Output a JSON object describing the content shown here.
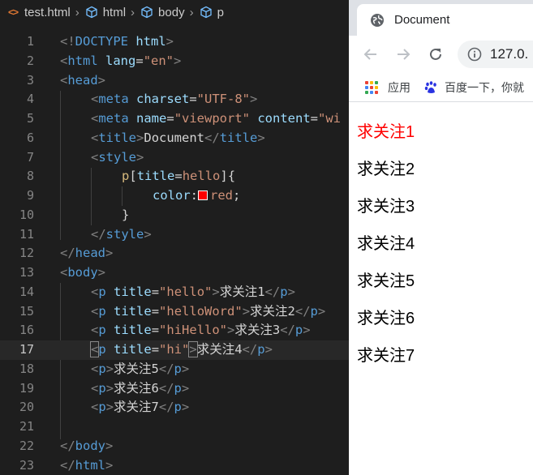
{
  "breadcrumb": {
    "file_icon": "<>",
    "file": "test.html",
    "items": [
      "html",
      "body",
      "p"
    ]
  },
  "editor": {
    "line_numbers": [
      "1",
      "2",
      "3",
      "4",
      "5",
      "6",
      "7",
      "8",
      "9",
      "10",
      "11",
      "12",
      "13",
      "14",
      "15",
      "16",
      "17",
      "18",
      "19",
      "20",
      "21",
      "22",
      "23"
    ],
    "lines": {
      "l1": {
        "a": "<!",
        "b": "DOCTYPE",
        "c": " html",
        "d": ">"
      },
      "l2": {
        "a": "<",
        "b": "html",
        "c": " lang",
        "d": "=",
        "e": "\"en\"",
        "f": ">"
      },
      "l3": {
        "a": "<",
        "b": "head",
        "c": ">"
      },
      "l4": {
        "a": "<",
        "b": "meta",
        "c": " charset",
        "d": "=",
        "e": "\"UTF-8\"",
        "f": ">"
      },
      "l5": {
        "a": "<",
        "b": "meta",
        "c": " name",
        "d": "=",
        "e": "\"viewport\"",
        "f": " content",
        "g": "=",
        "h": "\"wi"
      },
      "l6": {
        "a": "<",
        "b": "title",
        "c": ">",
        "d": "Document",
        "e": "</",
        "f": "title",
        "g": ">"
      },
      "l7": {
        "a": "<",
        "b": "style",
        "c": ">"
      },
      "l8": {
        "a": "p",
        "b": "[",
        "c": "title",
        "d": "=",
        "e": "hello",
        "f": "]",
        "g": "{"
      },
      "l9": {
        "a": "color",
        "b": ":",
        "c": "red",
        "d": ";"
      },
      "l10": {
        "a": "}"
      },
      "l11": {
        "a": "</",
        "b": "style",
        "c": ">"
      },
      "l12": {
        "a": "</",
        "b": "head",
        "c": ">"
      },
      "l13": {
        "a": "<",
        "b": "body",
        "c": ">"
      },
      "l14": {
        "a": "<",
        "b": "p",
        "c": " title",
        "d": "=",
        "e": "\"hello\"",
        "f": ">",
        "g": "求关注1",
        "h": "</",
        "i": "p",
        "j": ">"
      },
      "l15": {
        "a": "<",
        "b": "p",
        "c": " title",
        "d": "=",
        "e": "\"helloWord\"",
        "f": ">",
        "g": "求关注2",
        "h": "</",
        "i": "p",
        "j": ">"
      },
      "l16": {
        "a": "<",
        "b": "p",
        "c": " title",
        "d": "=",
        "e": "\"hiHello\"",
        "f": ">",
        "g": "求关注3",
        "h": "</",
        "i": "p",
        "j": ">"
      },
      "l17": {
        "a": "<",
        "b": "p",
        "c": " title",
        "d": "=",
        "e": "\"hi\"",
        "f": ">",
        "g": "求关注4",
        "h": "</",
        "i": "p",
        "j": ">"
      },
      "l18": {
        "a": "<",
        "b": "p",
        "c": ">",
        "d": "求关注5",
        "e": "</",
        "f": "p",
        "g": ">"
      },
      "l19": {
        "a": "<",
        "b": "p",
        "c": ">",
        "d": "求关注6",
        "e": "</",
        "f": "p",
        "g": ">"
      },
      "l20": {
        "a": "<",
        "b": "p",
        "c": ">",
        "d": "求关注7",
        "e": "</",
        "f": "p",
        "g": ">"
      },
      "l22": {
        "a": "</",
        "b": "body",
        "c": ">"
      },
      "l23": {
        "a": "</",
        "b": "html",
        "c": ">"
      }
    },
    "swatch_color": "#ff0000"
  },
  "browser": {
    "tab_title": "Document",
    "address": "127.0.",
    "bookmarks": [
      "应用",
      "百度一下，你就"
    ],
    "paragraphs": [
      "求关注1",
      "求关注2",
      "求关注3",
      "求关注4",
      "求关注5",
      "求关注6",
      "求关注7"
    ],
    "highlight_color": "#ff0000"
  }
}
